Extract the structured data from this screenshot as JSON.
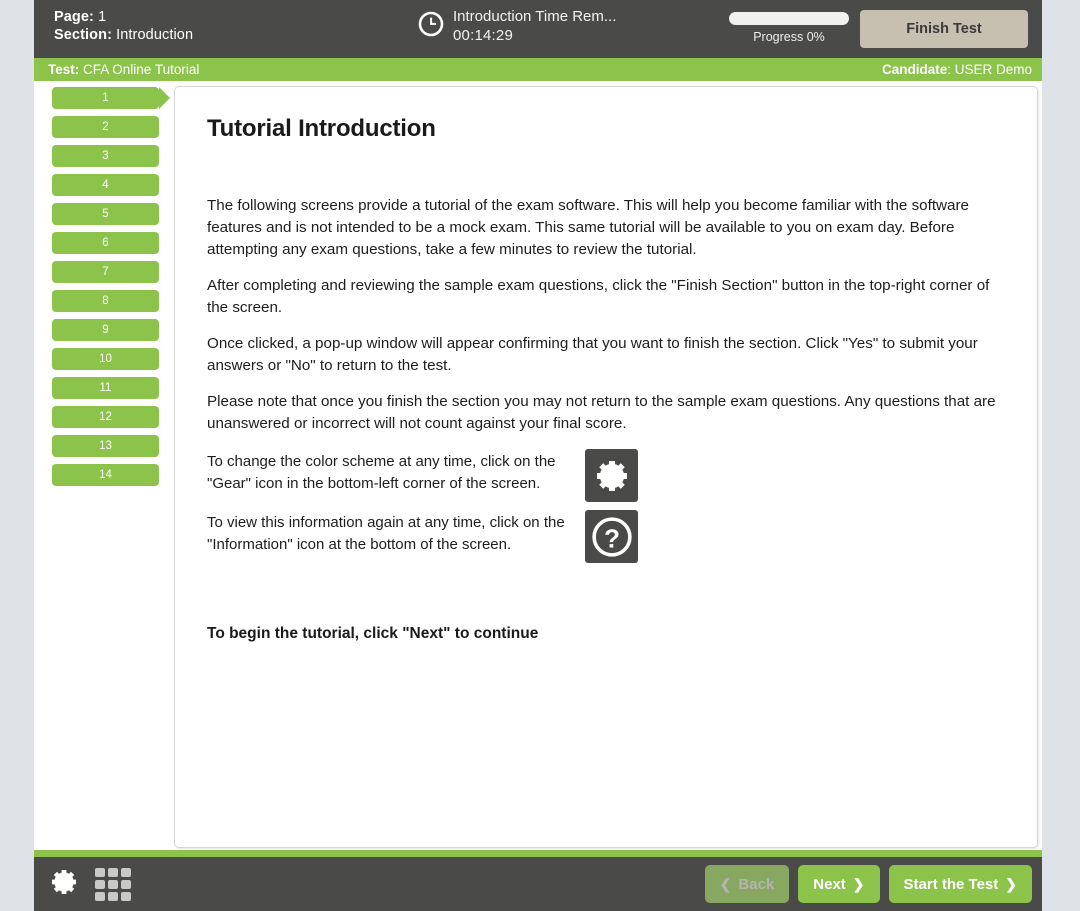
{
  "topbar": {
    "page_label": "Page:",
    "page_value": "1",
    "section_label": "Section:",
    "section_value": "Introduction",
    "timer_title": "Introduction Time Rem...",
    "timer_value": "00:14:29",
    "progress_label": "Progress 0%",
    "progress_percent": 0,
    "finish_test_label": "Finish Test",
    "clock_icon": "clock-icon"
  },
  "infobar": {
    "test_label": "Test:",
    "test_value": "CFA Online Tutorial",
    "candidate_label": "Candidate",
    "candidate_value": ": USER Demo"
  },
  "sidebar": {
    "current_index": 0,
    "items": [
      {
        "label": "1"
      },
      {
        "label": "2"
      },
      {
        "label": "3"
      },
      {
        "label": "4"
      },
      {
        "label": "5"
      },
      {
        "label": "6"
      },
      {
        "label": "7"
      },
      {
        "label": "8"
      },
      {
        "label": "9"
      },
      {
        "label": "10"
      },
      {
        "label": "11"
      },
      {
        "label": "12"
      },
      {
        "label": "13"
      },
      {
        "label": "14"
      }
    ]
  },
  "content": {
    "title": "Tutorial Introduction",
    "paragraphs": [
      "The following screens provide a tutorial of the exam software. This will help you become familiar with the software features and is not intended to be a mock exam. This same tutorial will be available to you on exam day. Before attempting any exam questions, take a few minutes to review the tutorial.",
      "After completing and reviewing the sample exam questions, click the \"Finish Section\" button in the top-right corner of the screen.",
      "Once clicked, a pop-up window will appear confirming that you want to finish the section. Click \"Yes\" to submit your answers or \"No\" to return to the test.",
      "Please note that once you finish the section you may not return to the sample exam questions. Any questions that are unanswered or incorrect will not count against your final score."
    ],
    "icon_rows": [
      {
        "text": "To change the color scheme at any time, click on the \"Gear\" icon in the bottom-left corner of the screen.",
        "icon": "gear-icon"
      },
      {
        "text": "To view this information again at any time, click on the \"Information\" icon at the bottom of the screen.",
        "icon": "question-mark-icon"
      }
    ],
    "closing_line": "To begin the tutorial, click \"Next\" to continue"
  },
  "footer": {
    "gear_icon": "gear-icon",
    "grid_icon": "grid-icon",
    "back_label": "Back",
    "next_label": "Next",
    "start_test_label": "Start the Test",
    "chevron_left": "❮",
    "chevron_right": "❯"
  },
  "colors": {
    "accent_green": "#8cc34a",
    "dark_bar": "#4a4a48",
    "finish_button": "#c7c0b1",
    "page_background": "#dde3e6"
  }
}
